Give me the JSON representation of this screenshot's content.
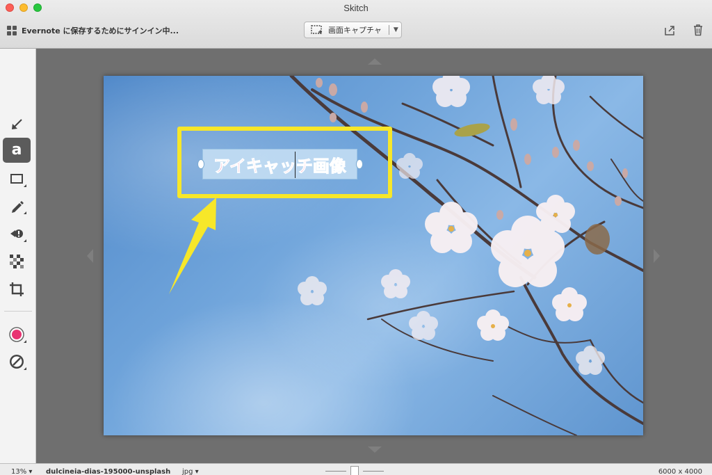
{
  "window": {
    "title": "Skitch"
  },
  "toolbar": {
    "signin_label": "Evernote に保存するためにサインイン中...",
    "capture_label": "画面キャプチャ"
  },
  "tools": [
    {
      "name": "arrow-tool",
      "icon": "arrow-icon",
      "active": false
    },
    {
      "name": "text-tool",
      "icon": "text-a-icon",
      "active": true
    },
    {
      "name": "shape-tool",
      "icon": "rectangle-icon",
      "active": false
    },
    {
      "name": "pen-tool",
      "icon": "pencil-icon",
      "active": false
    },
    {
      "name": "stamp-tool",
      "icon": "stamp-icon",
      "active": false
    },
    {
      "name": "pixelate-tool",
      "icon": "pixelate-icon",
      "active": false
    },
    {
      "name": "crop-tool",
      "icon": "crop-icon",
      "active": false
    },
    {
      "name": "color-picker",
      "icon": "color-dot-icon",
      "active": false
    },
    {
      "name": "line-width-picker",
      "icon": "line-width-icon",
      "active": false
    }
  ],
  "colors": {
    "annotation_text": "#e83372",
    "highlight_box": "#f7e729",
    "selected_color": "#e83372"
  },
  "annotation": {
    "text": "アイキャッチ画像"
  },
  "status": {
    "zoom": "13% ▾",
    "filename": "dulcineia-dias-195000-unsplash",
    "extension": "jpg ▾",
    "dimensions": "6000 x 4000"
  }
}
